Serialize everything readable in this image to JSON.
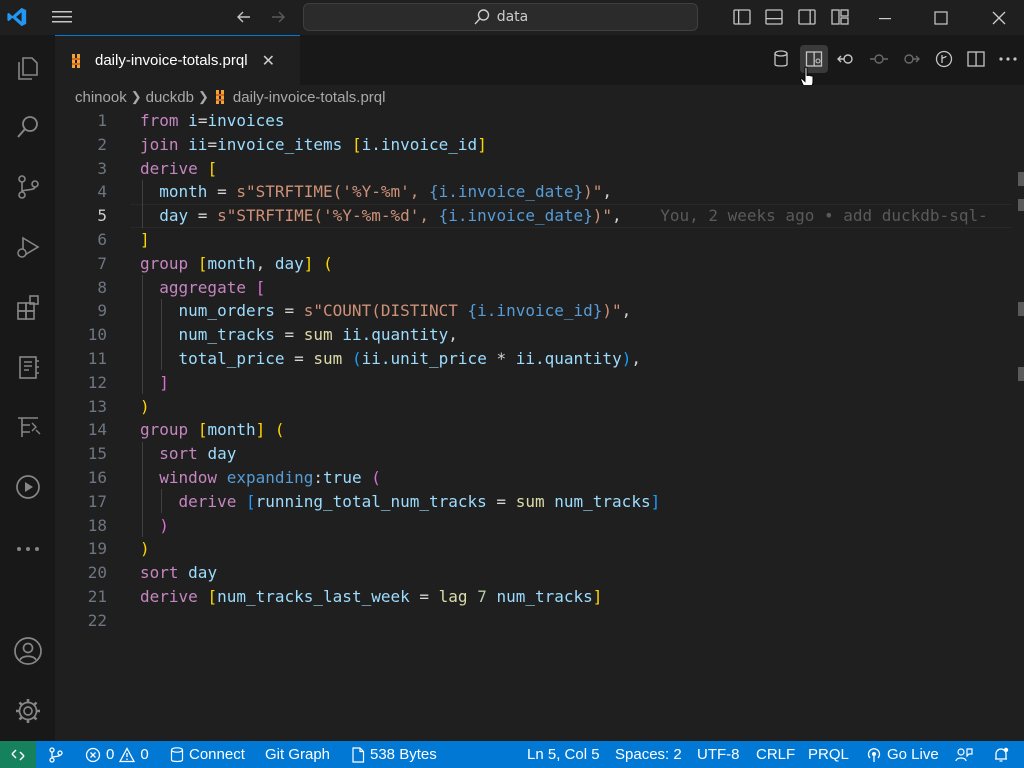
{
  "titlebar": {
    "search_text": "data",
    "icons": [
      "vscode-logo-icon",
      "menu-icon",
      "back-arrow-icon",
      "forward-arrow-icon",
      "toggle-primary-sidebar-icon",
      "toggle-panel-icon",
      "toggle-secondary-sidebar-icon",
      "customize-layout-icon",
      "minimize-icon",
      "maximize-icon",
      "close-icon"
    ]
  },
  "activitybar": {
    "items": [
      "explorer-icon",
      "search-icon",
      "source-control-icon",
      "run-debug-icon",
      "extensions-icon",
      "notebook-icon",
      "testing-icon",
      "run-icon",
      "more-icon"
    ],
    "bottom": [
      "accounts-icon",
      "manage-gear-icon"
    ]
  },
  "tab": {
    "label": "daily-invoice-totals.prql",
    "close": "✕"
  },
  "breadcrumb": {
    "items": [
      "chinook",
      "duckdb",
      "daily-invoice-totals.prql"
    ]
  },
  "editor": {
    "line_numbers": [
      "1",
      "2",
      "3",
      "4",
      "5",
      "6",
      "7",
      "8",
      "9",
      "10",
      "11",
      "12",
      "13",
      "14",
      "15",
      "16",
      "17",
      "18",
      "19",
      "20",
      "21",
      "22"
    ],
    "current_line": "5",
    "blame": "You, 2 weeks ago • add duckdb-sql-"
  },
  "statusbar": {
    "errors": "0",
    "warnings": "0",
    "connect": "Connect",
    "git_graph": "Git Graph",
    "file_size": "538 Bytes",
    "cursor": "Ln 5, Col 5",
    "spaces": "Spaces: 2",
    "encoding": "UTF-8",
    "eol": "CRLF",
    "language": "PRQL",
    "go_live": "Go Live"
  },
  "colors": {
    "accent": "#0078d4",
    "remote": "#16825d",
    "editor_bg": "#1f1f1f"
  }
}
